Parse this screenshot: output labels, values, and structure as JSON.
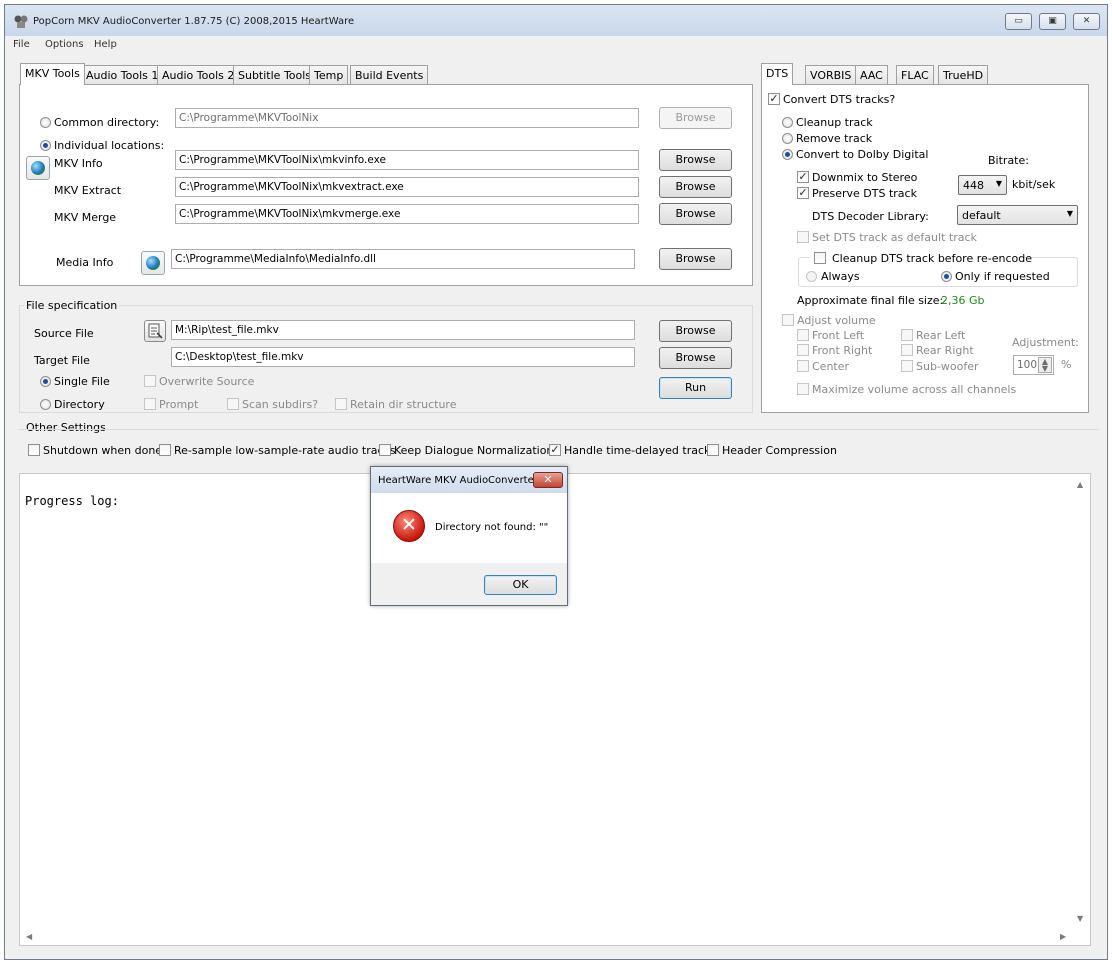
{
  "window": {
    "title": "PopCorn MKV AudioConverter 1.87.75 (C) 2008,2015 HeartWare",
    "minimize_icon": "minimize-icon",
    "maximize_icon": "maximize-icon",
    "close_icon": "close-icon"
  },
  "menu": [
    "File",
    "Options",
    "Help"
  ],
  "left_tabs": [
    "MKV Tools",
    "Audio Tools 1",
    "Audio Tools 2",
    "Subtitle Tools",
    "Temp",
    "Build Events"
  ],
  "mkv_tools": {
    "common_directory_label": "Common directory:",
    "common_directory_value": "C:\\Programme\\MKVToolNix",
    "individual_locations_label": "Individual locations:",
    "mkv_info_label": "MKV Info",
    "mkv_info_value": "C:\\Programme\\MKVToolNix\\mkvinfo.exe",
    "mkv_extract_label": "MKV Extract",
    "mkv_extract_value": "C:\\Programme\\MKVToolNix\\mkvextract.exe",
    "mkv_merge_label": "MKV Merge",
    "mkv_merge_value": "C:\\Programme\\MKVToolNix\\mkvmerge.exe",
    "media_info_label": "Media Info",
    "media_info_value": "C:\\Programme\\MediaInfo\\MediaInfo.dll",
    "browse_label": "Browse"
  },
  "file_spec": {
    "title": "File specification",
    "source_label": "Source File",
    "source_value": "M:\\Rip\\test_file.mkv",
    "target_label": "Target File",
    "target_value": "C:\\Desktop\\test_file.mkv",
    "single_file_label": "Single File",
    "directory_label": "Directory",
    "overwrite_label": "Overwrite Source",
    "prompt_label": "Prompt",
    "scan_subdirs_label": "Scan subdirs?",
    "retain_dir_label": "Retain dir structure",
    "run_label": "Run"
  },
  "right_tabs": [
    "DTS",
    "VORBIS",
    "AAC",
    "FLAC",
    "TrueHD"
  ],
  "dts": {
    "convert_label": "Convert DTS tracks?",
    "cleanup_label": "Cleanup track",
    "remove_label": "Remove track",
    "convert_dd_label": "Convert to Dolby Digital",
    "bitrate_label": "Bitrate:",
    "bitrate_value": "448",
    "bitrate_unit": "kbit/sek",
    "downmix_label": "Downmix to Stereo",
    "preserve_label": "Preserve DTS track",
    "decoder_label": "DTS Decoder Library:",
    "decoder_value": "default",
    "set_default_label": "Set DTS track as default track",
    "cleanup_before_label": "Cleanup DTS track before re-encode",
    "always_label": "Always",
    "only_requested_label": "Only if requested",
    "approx_label": "Approximate final file size:",
    "approx_value": "2,36 Gb",
    "adjust_volume_label": "Adjust volume",
    "front_left_label": "Front Left",
    "front_right_label": "Front Right",
    "center_label": "Center",
    "rear_left_label": "Rear Left",
    "rear_right_label": "Rear Right",
    "subwoofer_label": "Sub-woofer",
    "adjustment_label": "Adjustment:",
    "adjustment_value": "100",
    "adjustment_unit": "%",
    "maximize_label": "Maximize volume across all channels"
  },
  "other_settings": {
    "title": "Other Settings",
    "shutdown_label": "Shutdown when done",
    "resample_label": "Re-sample low-sample-rate audio tracks",
    "keep_dialogue_label": "Keep Dialogue Normalization",
    "handle_delayed_label": "Handle time-delayed tracks",
    "header_compression_label": "Header Compression"
  },
  "log": {
    "text": "Progress log:"
  },
  "dialog": {
    "title": "HeartWare MKV AudioConverter",
    "message": "Directory not found: \"\"",
    "ok_label": "OK",
    "close_glyph": "✕"
  },
  "colors": {
    "accent": "#3c7fb1",
    "approx_value": "#1f8a1f",
    "error": "#c8160c"
  }
}
